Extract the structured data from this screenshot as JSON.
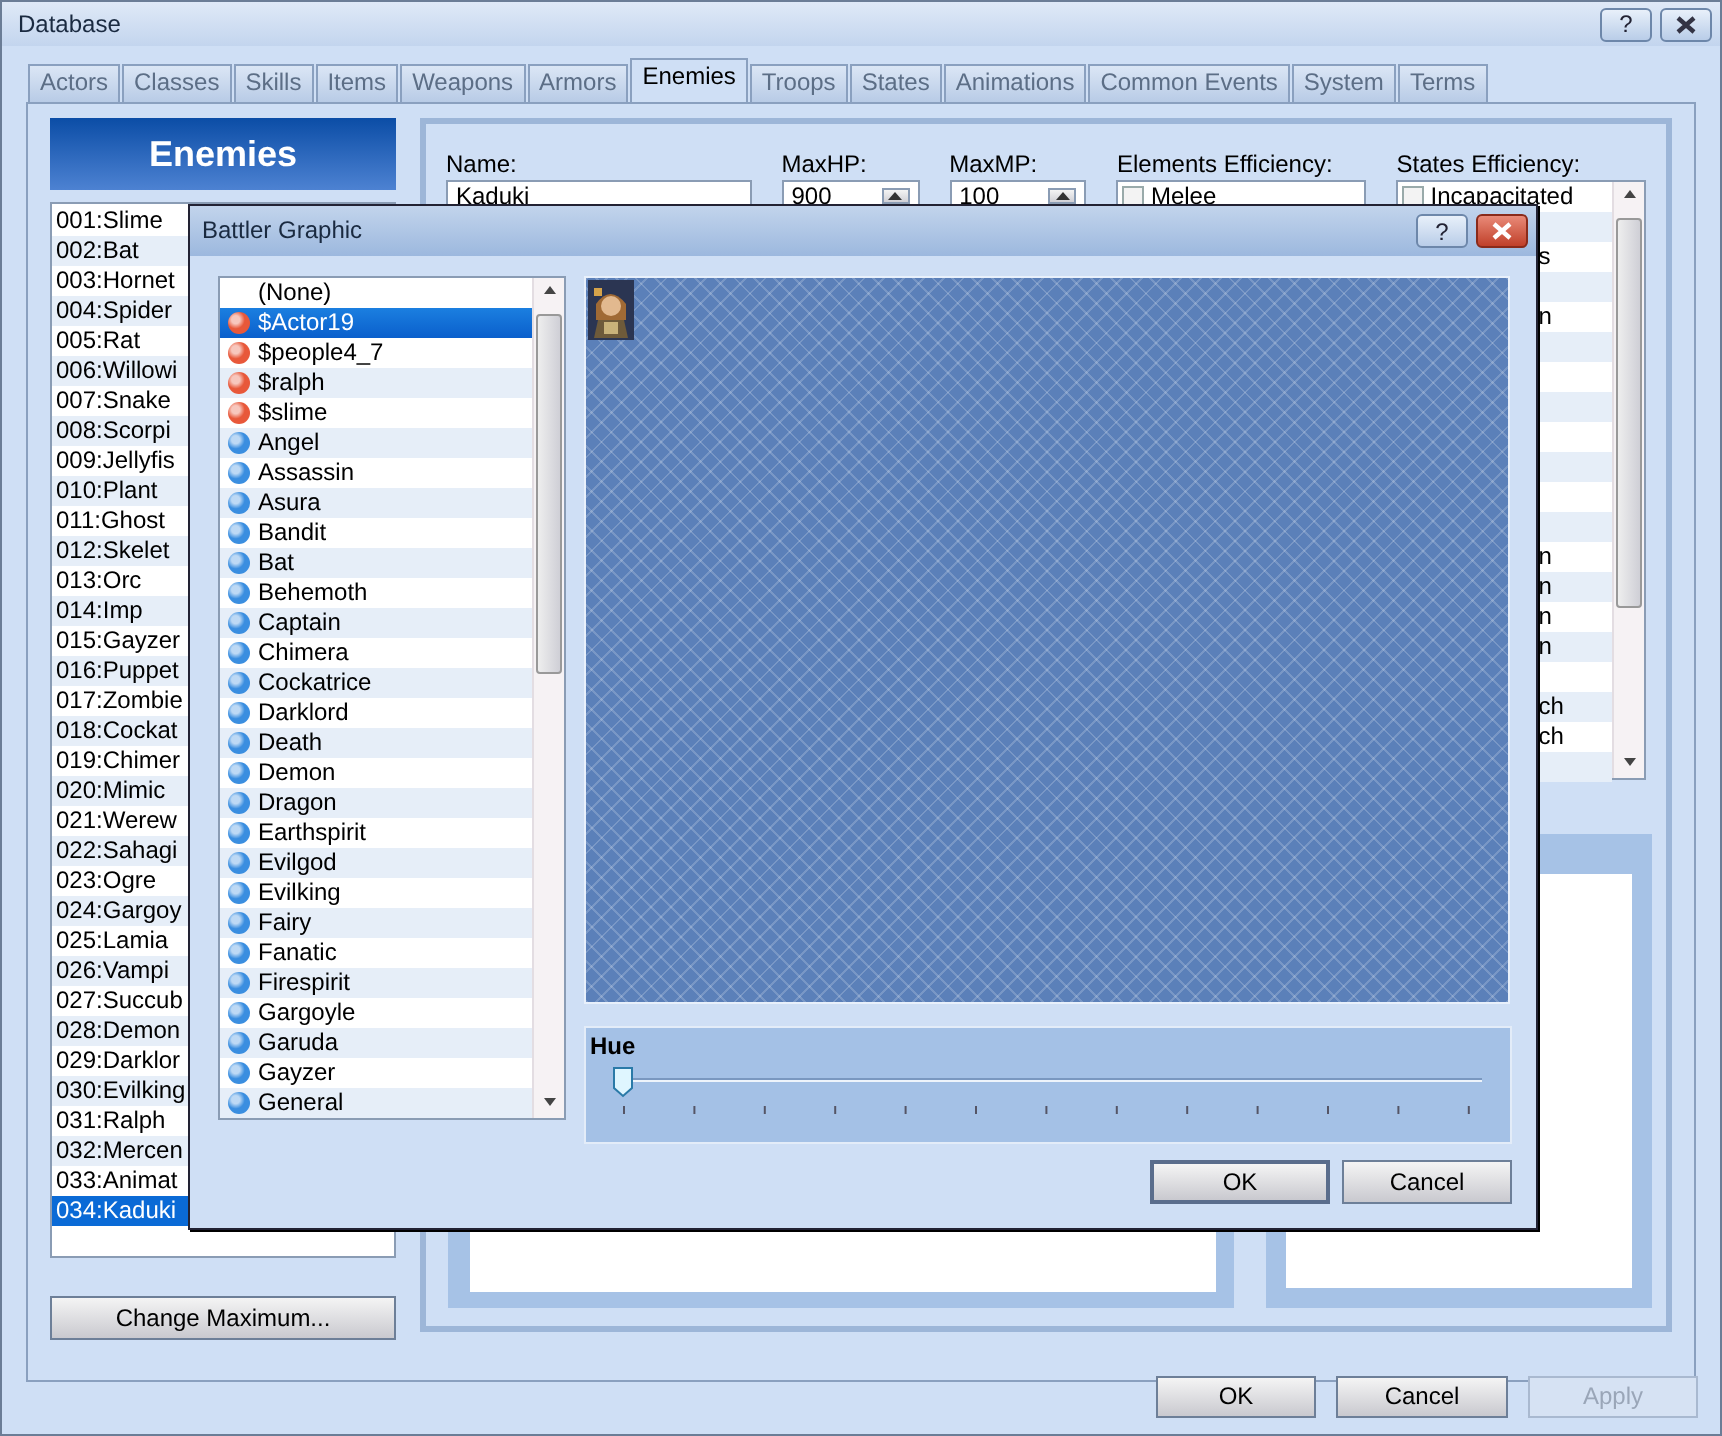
{
  "window": {
    "title": "Database",
    "help": "?"
  },
  "tabs": [
    {
      "label": "Actors",
      "selected": false
    },
    {
      "label": "Classes",
      "selected": false
    },
    {
      "label": "Skills",
      "selected": false
    },
    {
      "label": "Items",
      "selected": false
    },
    {
      "label": "Weapons",
      "selected": false
    },
    {
      "label": "Armors",
      "selected": false
    },
    {
      "label": "Enemies",
      "selected": true
    },
    {
      "label": "Troops",
      "selected": false
    },
    {
      "label": "States",
      "selected": false
    },
    {
      "label": "Animations",
      "selected": false
    },
    {
      "label": "Common Events",
      "selected": false
    },
    {
      "label": "System",
      "selected": false
    },
    {
      "label": "Terms",
      "selected": false
    }
  ],
  "enemies_panel": {
    "header": "Enemies",
    "change_button": "Change Maximum...",
    "items": [
      {
        "label": "001:Slime",
        "selected": false
      },
      {
        "label": "002:Bat",
        "selected": false
      },
      {
        "label": "003:Hornet",
        "selected": false
      },
      {
        "label": "004:Spider",
        "selected": false
      },
      {
        "label": "005:Rat",
        "selected": false
      },
      {
        "label": "006:Willowi",
        "selected": false
      },
      {
        "label": "007:Snake",
        "selected": false
      },
      {
        "label": "008:Scorpi",
        "selected": false
      },
      {
        "label": "009:Jellyfis",
        "selected": false
      },
      {
        "label": "010:Plant",
        "selected": false
      },
      {
        "label": "011:Ghost",
        "selected": false
      },
      {
        "label": "012:Skelet",
        "selected": false
      },
      {
        "label": "013:Orc",
        "selected": false
      },
      {
        "label": "014:Imp",
        "selected": false
      },
      {
        "label": "015:Gayzer",
        "selected": false
      },
      {
        "label": "016:Puppet",
        "selected": false
      },
      {
        "label": "017:Zombie",
        "selected": false
      },
      {
        "label": "018:Cockat",
        "selected": false
      },
      {
        "label": "019:Chimer",
        "selected": false
      },
      {
        "label": "020:Mimic",
        "selected": false
      },
      {
        "label": "021:Werew",
        "selected": false
      },
      {
        "label": "022:Sahagi",
        "selected": false
      },
      {
        "label": "023:Ogre",
        "selected": false
      },
      {
        "label": "024:Gargoy",
        "selected": false
      },
      {
        "label": "025:Lamia",
        "selected": false
      },
      {
        "label": "026:Vampi",
        "selected": false
      },
      {
        "label": "027:Succub",
        "selected": false
      },
      {
        "label": "028:Demon",
        "selected": false
      },
      {
        "label": "029:Darklor",
        "selected": false
      },
      {
        "label": "030:Evilking",
        "selected": false
      },
      {
        "label": "031:Ralph",
        "selected": false
      },
      {
        "label": "032:Mercen",
        "selected": false
      },
      {
        "label": "033:Animat",
        "selected": false
      },
      {
        "label": "034:Kaduki",
        "selected": true
      }
    ]
  },
  "fields": [
    {
      "label": "Name:",
      "value": "Kaduki",
      "kind": "text"
    },
    {
      "label": "MaxHP:",
      "value": "900",
      "kind": "spin"
    },
    {
      "label": "MaxMP:",
      "value": "100",
      "kind": "spin"
    }
  ],
  "elements": {
    "label": "Elements Efficiency:",
    "rows": [
      {
        "label": "Melee",
        "checked": false
      }
    ]
  },
  "states": {
    "label": "States Efficiency:",
    "rows": [
      {
        "label": "Incapacitated",
        "checked": false
      },
      {},
      {
        "label": "s"
      },
      {},
      {
        "label": "n"
      },
      {},
      {},
      {},
      {},
      {},
      {},
      {},
      {
        "label": "n"
      },
      {
        "label": "n"
      },
      {
        "label": "n"
      },
      {
        "label": "n"
      },
      {},
      {
        "label": "ch"
      },
      {
        "label": "ch"
      },
      {}
    ]
  },
  "footer_buttons": [
    {
      "label": "OK",
      "disabled": false
    },
    {
      "label": "Cancel",
      "disabled": false
    },
    {
      "label": "Apply",
      "disabled": true
    }
  ],
  "dialog": {
    "title": "Battler Graphic",
    "help": "?",
    "graphics": [
      {
        "label": "(None)",
        "selected": false
      },
      {
        "label": "$Actor19",
        "selected": true,
        "color": "#e8583a"
      },
      {
        "label": "$people4_7",
        "selected": false,
        "color": "#e8583a"
      },
      {
        "label": "$ralph",
        "selected": false,
        "color": "#e8583a"
      },
      {
        "label": "$slime",
        "selected": false,
        "color": "#e8583a"
      },
      {
        "label": "Angel",
        "selected": false,
        "color": "#3a8ee0"
      },
      {
        "label": "Assassin",
        "selected": false,
        "color": "#3a8ee0"
      },
      {
        "label": "Asura",
        "selected": false,
        "color": "#3a8ee0"
      },
      {
        "label": "Bandit",
        "selected": false,
        "color": "#3a8ee0"
      },
      {
        "label": "Bat",
        "selected": false,
        "color": "#3a8ee0"
      },
      {
        "label": "Behemoth",
        "selected": false,
        "color": "#3a8ee0"
      },
      {
        "label": "Captain",
        "selected": false,
        "color": "#3a8ee0"
      },
      {
        "label": "Chimera",
        "selected": false,
        "color": "#3a8ee0"
      },
      {
        "label": "Cockatrice",
        "selected": false,
        "color": "#3a8ee0"
      },
      {
        "label": "Darklord",
        "selected": false,
        "color": "#3a8ee0"
      },
      {
        "label": "Death",
        "selected": false,
        "color": "#3a8ee0"
      },
      {
        "label": "Demon",
        "selected": false,
        "color": "#3a8ee0"
      },
      {
        "label": "Dragon",
        "selected": false,
        "color": "#3a8ee0"
      },
      {
        "label": "Earthspirit",
        "selected": false,
        "color": "#3a8ee0"
      },
      {
        "label": "Evilgod",
        "selected": false,
        "color": "#3a8ee0"
      },
      {
        "label": "Evilking",
        "selected": false,
        "color": "#3a8ee0"
      },
      {
        "label": "Fairy",
        "selected": false,
        "color": "#3a8ee0"
      },
      {
        "label": "Fanatic",
        "selected": false,
        "color": "#3a8ee0"
      },
      {
        "label": "Firespirit",
        "selected": false,
        "color": "#3a8ee0"
      },
      {
        "label": "Gargoyle",
        "selected": false,
        "color": "#3a8ee0"
      },
      {
        "label": "Garuda",
        "selected": false,
        "color": "#3a8ee0"
      },
      {
        "label": "Gayzer",
        "selected": false,
        "color": "#3a8ee0"
      },
      {
        "label": "General",
        "selected": false,
        "color": "#3a8ee0"
      }
    ],
    "hue": {
      "label": "Hue",
      "level": 0
    },
    "buttons": [
      {
        "label": "OK",
        "default": true
      },
      {
        "label": "Cancel",
        "default": false
      }
    ]
  }
}
